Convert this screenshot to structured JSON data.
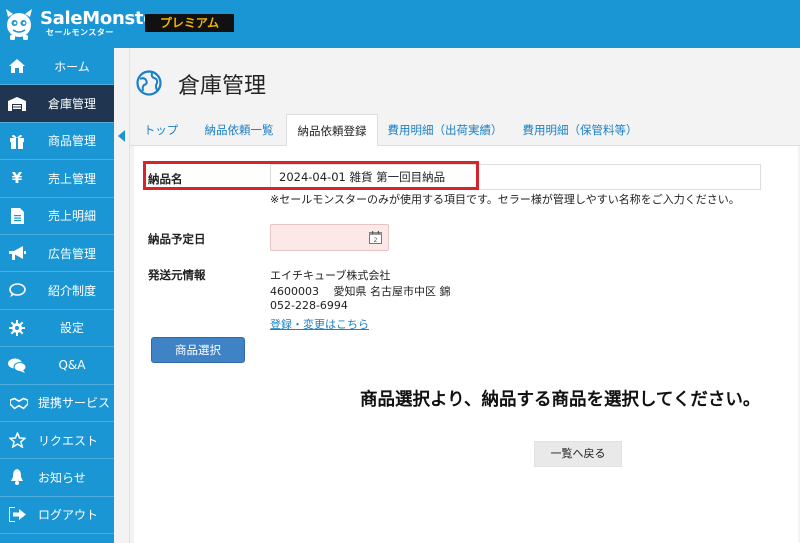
{
  "header": {
    "logo_main": "SaleMonster",
    "logo_sub": "セールモンスター",
    "plan_badge": "プレミアム",
    "brand_color": "#1a96d4"
  },
  "sidebar": {
    "items": [
      {
        "label": "ホーム",
        "icon": "home-icon"
      },
      {
        "label": "倉庫管理",
        "icon": "warehouse-icon",
        "active": true
      },
      {
        "label": "商品管理",
        "icon": "gift-icon"
      },
      {
        "label": "売上管理",
        "icon": "yen-icon"
      },
      {
        "label": "売上明細",
        "icon": "document-icon"
      },
      {
        "label": "広告管理",
        "icon": "megaphone-icon"
      },
      {
        "label": "紹介制度",
        "icon": "speech-bubble-icon"
      },
      {
        "label": "設定",
        "icon": "gear-icon"
      },
      {
        "label": "Q&A",
        "icon": "chat-icon"
      },
      {
        "label": "提携サービス",
        "icon": "handshake-icon"
      },
      {
        "label": "リクエスト",
        "icon": "star-icon"
      },
      {
        "label": "お知らせ",
        "icon": "bell-icon"
      },
      {
        "label": "ログアウト",
        "icon": "logout-icon"
      }
    ]
  },
  "page": {
    "title": "倉庫管理"
  },
  "tabs": [
    {
      "label": "トップ"
    },
    {
      "label": "納品依頼一覧"
    },
    {
      "label": "納品依頼登録",
      "active": true
    },
    {
      "label": "費用明細（出荷実績）"
    },
    {
      "label": "費用明細（保管料等）"
    }
  ],
  "form": {
    "delivery_name_label": "納品名",
    "delivery_name_value": "2024-04-01 雑貨 第一回目納品",
    "delivery_name_hint": "※セールモンスターのみが使用する項目です。セラー様が管理しやすい名称をご入力ください。",
    "delivery_date_label": "納品予定日",
    "delivery_date_value": "",
    "sender_label": "発送元情報",
    "sender_company": "エイチキューブ株式会社",
    "sender_address": "4600003　 愛知県 名古屋市中区 錦",
    "sender_phone": "052-228-6994",
    "sender_edit_link": "登録・変更はこちら",
    "select_button": "商品選択",
    "instruction": "商品選択より、納品する商品を選択してください。",
    "back_button": "一覧へ戻る",
    "highlight_color": "#d8232a"
  }
}
